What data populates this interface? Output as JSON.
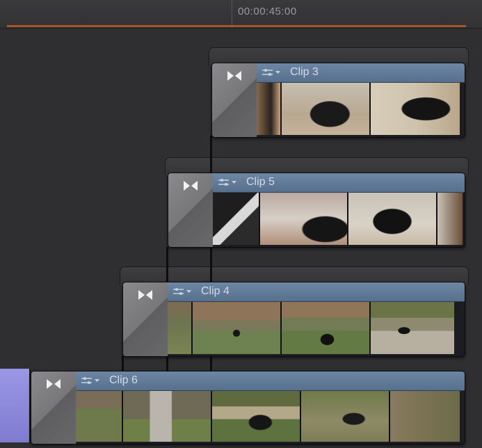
{
  "timeline": {
    "timecode": "00:00:45:00"
  },
  "clips": [
    {
      "id": "clip3",
      "title": "Clip 3"
    },
    {
      "id": "clip5",
      "title": "Clip 5"
    },
    {
      "id": "clip4",
      "title": "Clip 4"
    },
    {
      "id": "clip6",
      "title": "Clip 6"
    }
  ],
  "icons": {
    "transition": "bowtie-transition-icon",
    "clip_settings": "clip-settings-icon"
  },
  "colors": {
    "clip_header": "#5e7896",
    "playhead_bar": "#a8552a",
    "purple_clip": "#8f8bdc"
  }
}
